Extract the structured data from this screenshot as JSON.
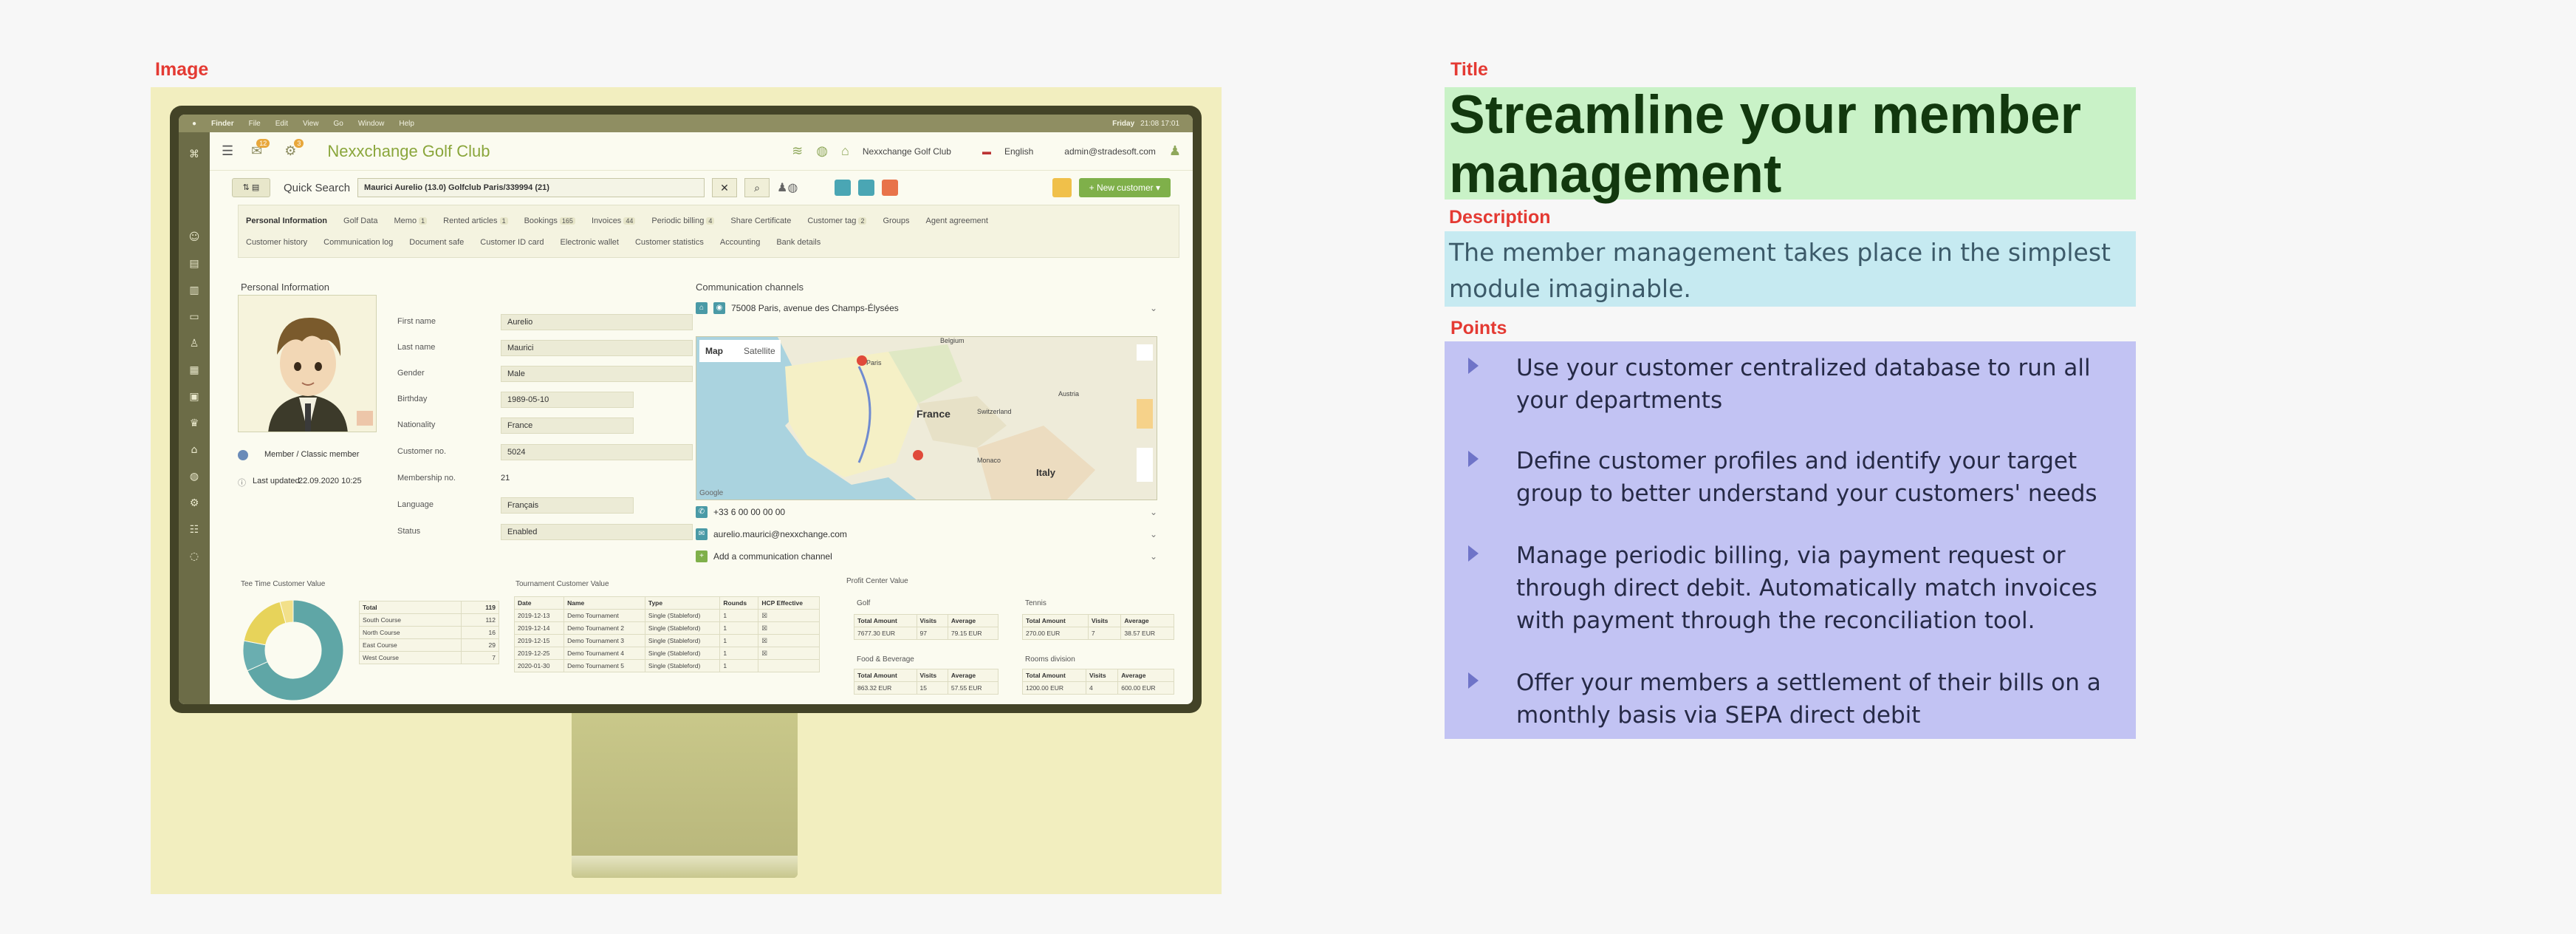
{
  "labels": {
    "image": "Image",
    "title": "Title",
    "description": "Description",
    "points": "Points"
  },
  "title": "Streamline your member management",
  "description": "The member management takes place in the simplest module imaginable.",
  "points": [
    "Use your customer centralized database to run all your departments",
    "Define customer profiles and identify your target group to better understand your customers' needs",
    "Manage periodic billing, via payment request or through direct debit. Automatically match invoices with payment through the reconciliation tool.",
    "Offer your members a settlement of their bills on a monthly basis via SEPA direct debit"
  ],
  "screen": {
    "menubar": {
      "items": [
        "Finder",
        "File",
        "Edit",
        "View",
        "Go",
        "Window",
        "Help"
      ],
      "clock_day": "Friday",
      "clock_time": "21:08 17:01"
    },
    "header": {
      "brand": "Nexxchange Golf Club",
      "club": "Nexxchange Golf Club",
      "language": "English",
      "user": "admin@stradesoft.com",
      "notif_count": "12",
      "settings_count": "3"
    },
    "quick_search": {
      "label": "Quick Search",
      "value": "Maurici Aurelio (13.0) Golfclub Paris/339994 (21)",
      "new_customer": "New customer"
    },
    "tabs_row1": [
      "Personal Information",
      "Golf Data",
      "Memo",
      "Rented articles",
      "Bookings",
      "Invoices",
      "Periodic billing",
      "Share Certificate",
      "Customer tag",
      "Groups",
      "Agent agreement"
    ],
    "tab_counts": {
      "Memo": "1",
      "Rented articles": "1",
      "Bookings": "165",
      "Invoices": "44",
      "Periodic billing": "4",
      "Customer tag": "2"
    },
    "tabs_row2": [
      "Customer history",
      "Communication log",
      "Document safe",
      "Customer ID card",
      "Electronic wallet",
      "Customer statistics",
      "Accounting",
      "Bank details"
    ],
    "personal": {
      "title": "Personal Information",
      "membership_line": "Member / Classic member",
      "last_updated_label": "Last updated",
      "last_updated": "22.09.2020 10:25",
      "fields": [
        {
          "label": "First name",
          "value": "Aurelio"
        },
        {
          "label": "Last name",
          "value": "Maurici"
        },
        {
          "label": "Gender",
          "value": "Male"
        },
        {
          "label": "Birthday",
          "value": "1989-05-10"
        },
        {
          "label": "Nationality",
          "value": "France"
        },
        {
          "label": "Customer no.",
          "value": "5024"
        },
        {
          "label": "Membership no.",
          "value": "21"
        },
        {
          "label": "Language",
          "value": "Français"
        },
        {
          "label": "Status",
          "value": "Enabled"
        }
      ]
    },
    "comm": {
      "title": "Communication channels",
      "address": "75008 Paris, avenue des Champs-Élysées",
      "map_tab": "Map",
      "satellite_tab": "Satellite",
      "map_labels": [
        "France",
        "Italy",
        "Belgium",
        "Switzerland",
        "Austria",
        "Paris",
        "Monaco"
      ],
      "phone": "+33 6 00 00 00 00",
      "email": "aurelio.maurici@nexxchange.com",
      "add_channel": "Add a communication channel",
      "map_credit": "Google"
    },
    "tee_time": {
      "title": "Tee Time Customer Value",
      "total_label": "Total",
      "total": "119",
      "rows": [
        [
          "South Course",
          "112"
        ],
        [
          "North Course",
          "16"
        ],
        [
          "East Course",
          "29"
        ],
        [
          "West Course",
          "7"
        ]
      ],
      "chart_data": {
        "type": "pie",
        "categories": [
          "South Course",
          "North Course",
          "East Course",
          "West Course"
        ],
        "values": [
          112,
          16,
          29,
          7
        ]
      }
    },
    "tournament": {
      "title": "Tournament Customer Value",
      "headers": [
        "Date",
        "Name",
        "Type",
        "Rounds",
        "HCP Effective"
      ],
      "rows": [
        [
          "2019-12-13",
          "Demo Tournament",
          "Single (Stableford)",
          "1",
          "☒"
        ],
        [
          "2019-12-14",
          "Demo Tournament 2",
          "Single (Stableford)",
          "1",
          "☒"
        ],
        [
          "2019-12-15",
          "Demo Tournament 3",
          "Single (Stableford)",
          "1",
          "☒"
        ],
        [
          "2019-12-25",
          "Demo Tournament 4",
          "Single (Stableford)",
          "1",
          "☒"
        ],
        [
          "2020-01-30",
          "Demo Tournament 5",
          "Single (Stableford)",
          "1",
          ""
        ]
      ]
    },
    "profit": {
      "title": "Profit Center Value",
      "headers": [
        "Total Amount",
        "Visits",
        "Average"
      ],
      "golf": {
        "title": "Golf",
        "row": [
          "7677.30 EUR",
          "97",
          "79.15 EUR"
        ]
      },
      "tennis": {
        "title": "Tennis",
        "row": [
          "270.00 EUR",
          "7",
          "38.57 EUR"
        ]
      },
      "fnb": {
        "title": "Food & Beverage",
        "row": [
          "863.32 EUR",
          "15",
          "57.55 EUR"
        ]
      },
      "rooms": {
        "title": "Rooms division",
        "row": [
          "1200.00 EUR",
          "4",
          "600.00 EUR"
        ]
      }
    }
  }
}
